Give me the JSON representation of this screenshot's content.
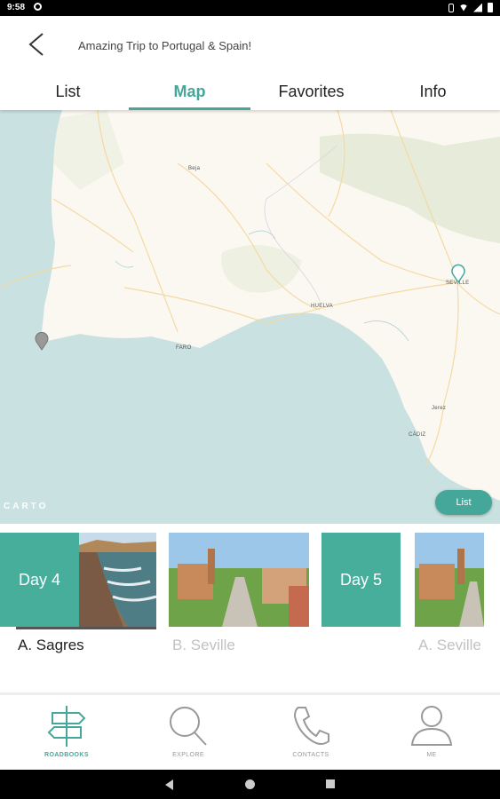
{
  "status_bar": {
    "time": "9:58"
  },
  "header": {
    "title": "Amazing Trip to Portugal & Spain!"
  },
  "tabs": [
    {
      "label": "List"
    },
    {
      "label": "Map",
      "active": true
    },
    {
      "label": "Favorites"
    },
    {
      "label": "Info"
    }
  ],
  "map": {
    "labels": [
      "Beja",
      "HUELVA",
      "FARO",
      "SEVILLE",
      "Jerez",
      "CÁDIZ"
    ],
    "attribution": "CARTO",
    "list_button": "List",
    "colors": {
      "sea": "#c9e1e0",
      "land": "#fbf8f1",
      "park": "#e6ecd9",
      "road": "#f4d9a3"
    }
  },
  "cards": [
    {
      "day_label": "Day 4",
      "place": "A. Sagres",
      "active": true
    },
    {
      "day_label": "",
      "place": "B. Seville",
      "active": false
    },
    {
      "day_label": "Day 5",
      "place": "",
      "active": false
    },
    {
      "day_label": "",
      "place": "A. Seville",
      "active": false
    }
  ],
  "bottom_nav": [
    {
      "label": "ROADBOOKS",
      "icon": "signpost-icon",
      "active": true
    },
    {
      "label": "EXPLORE",
      "icon": "search-icon"
    },
    {
      "label": "CONTACTS",
      "icon": "phone-icon"
    },
    {
      "label": "ME",
      "icon": "user-icon"
    }
  ],
  "accent_color": "#44a79a"
}
